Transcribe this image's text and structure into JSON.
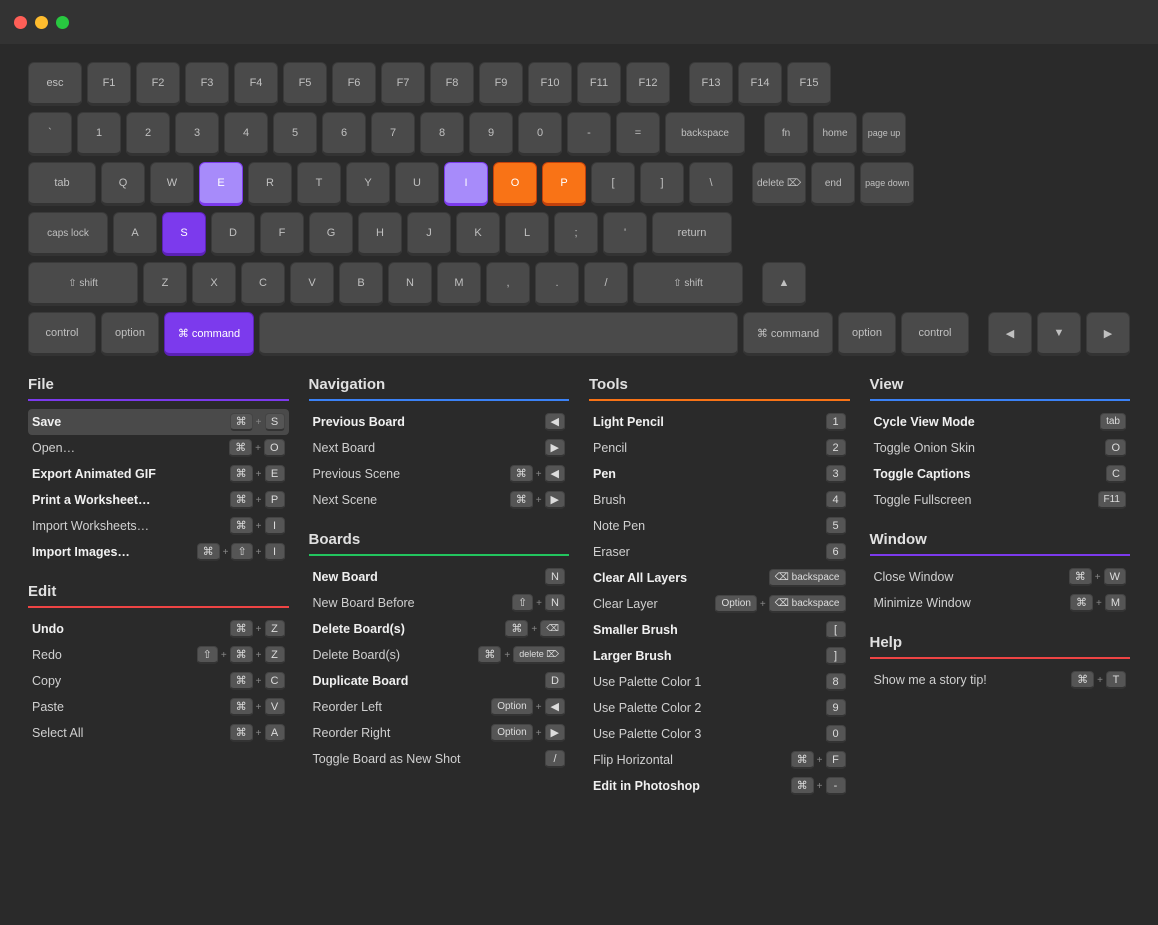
{
  "titleBar": {
    "dots": [
      "red",
      "yellow",
      "green"
    ]
  },
  "keyboard": {
    "rows": [
      [
        "esc",
        "F1",
        "F2",
        "F3",
        "F4",
        "F5",
        "F6",
        "F7",
        "F8",
        "F9",
        "F10",
        "F11",
        "F12",
        "F13",
        "F14",
        "F15"
      ],
      [
        "`",
        "1",
        "2",
        "3",
        "4",
        "5",
        "6",
        "7",
        "8",
        "9",
        "0",
        "-",
        "=",
        "backspace",
        "fn",
        "home",
        "page up"
      ],
      [
        "tab",
        "Q",
        "W",
        "E",
        "R",
        "T",
        "Y",
        "U",
        "I",
        "O",
        "P",
        "[",
        "]",
        "\\",
        "delete",
        "end",
        "page down"
      ],
      [
        "caps lock",
        "A",
        "S",
        "D",
        "F",
        "G",
        "H",
        "J",
        "K",
        "L",
        ";",
        "'",
        "return"
      ],
      [
        "shift",
        "Z",
        "X",
        "C",
        "V",
        "B",
        "N",
        "M",
        ",",
        ".",
        "/",
        "shift"
      ],
      [
        "control",
        "option",
        "command",
        "",
        "command",
        "option",
        "control"
      ]
    ]
  },
  "sections": {
    "file": {
      "title": "File",
      "dividerClass": "divider-purple",
      "items": [
        {
          "label": "Save",
          "bold": true,
          "keys": [
            "⌘",
            "S"
          ],
          "highlighted": true
        },
        {
          "label": "Open…",
          "keys": [
            "⌘",
            "O"
          ]
        },
        {
          "label": "Export Animated GIF",
          "bold": true,
          "keys": [
            "⌘",
            "E"
          ]
        },
        {
          "label": "Print a Worksheet…",
          "bold": true,
          "keys": [
            "⌘",
            "P"
          ]
        },
        {
          "label": "Import Worksheets…",
          "keys": [
            "⌘",
            "I"
          ]
        },
        {
          "label": "Import Images…",
          "bold": true,
          "keys": [
            "⌘",
            "⇧",
            "I"
          ]
        }
      ]
    },
    "edit": {
      "title": "Edit",
      "dividerClass": "divider-red",
      "items": [
        {
          "label": "Undo",
          "bold": true,
          "keys": [
            "⌘",
            "Z"
          ]
        },
        {
          "label": "Redo",
          "keys": [
            "⇧",
            "⌘",
            "Z"
          ]
        },
        {
          "label": "Copy",
          "keys": [
            "⌘",
            "C"
          ]
        },
        {
          "label": "Paste",
          "keys": [
            "⌘",
            "V"
          ]
        },
        {
          "label": "Select All",
          "keys": [
            "⌘",
            "A"
          ]
        }
      ]
    },
    "navigation": {
      "title": "Navigation",
      "dividerClass": "divider-blue",
      "items": [
        {
          "label": "Previous Board",
          "bold": true,
          "keys": [
            "◀"
          ]
        },
        {
          "label": "Next Board",
          "keys": [
            "▶"
          ]
        },
        {
          "label": "Previous Scene",
          "keys": [
            "⌘",
            "◀"
          ]
        },
        {
          "label": "Next Scene",
          "keys": [
            "⌘",
            "▶"
          ]
        }
      ]
    },
    "boards": {
      "title": "Boards",
      "dividerClass": "divider-green",
      "items": [
        {
          "label": "New Board",
          "bold": true,
          "keys": [
            "N"
          ]
        },
        {
          "label": "New Board Before",
          "keys": [
            "⇧",
            "N"
          ]
        },
        {
          "label": "Delete Board(s)",
          "bold": true,
          "keys": [
            "⌘",
            "⌫"
          ]
        },
        {
          "label": "Delete Board(s)",
          "keys": [
            "⌘",
            "delete"
          ]
        },
        {
          "label": "Duplicate Board",
          "bold": true,
          "keys": [
            "D"
          ]
        },
        {
          "label": "Reorder Left",
          "keys": [
            "Option",
            "◀"
          ]
        },
        {
          "label": "Reorder Right",
          "keys": [
            "Option",
            "▶"
          ]
        },
        {
          "label": "Toggle Board as New Shot",
          "keys": [
            "/"
          ]
        },
        {
          "label": "",
          "keys": []
        }
      ]
    },
    "tools": {
      "title": "Tools",
      "dividerClass": "divider-orange",
      "items": [
        {
          "label": "Light Pencil",
          "bold": true,
          "keys": [
            "1"
          ]
        },
        {
          "label": "Pencil",
          "keys": [
            "2"
          ]
        },
        {
          "label": "Pen",
          "bold": true,
          "keys": [
            "3"
          ]
        },
        {
          "label": "Brush",
          "keys": [
            "4"
          ]
        },
        {
          "label": "Note Pen",
          "keys": [
            "5"
          ]
        },
        {
          "label": "Eraser",
          "keys": [
            "6"
          ]
        },
        {
          "label": "Clear All Layers",
          "bold": true,
          "keys": [
            "⌫"
          ]
        },
        {
          "label": "Clear Layer",
          "keys": [
            "Option",
            "⌫"
          ]
        },
        {
          "label": "Smaller Brush",
          "bold": true,
          "keys": [
            "["
          ]
        },
        {
          "label": "Larger Brush",
          "bold": true,
          "keys": [
            "]"
          ]
        },
        {
          "label": "Use Palette Color 1",
          "keys": [
            "8"
          ]
        },
        {
          "label": "Use Palette Color 2",
          "keys": [
            "9"
          ]
        },
        {
          "label": "Use Palette Color 3",
          "keys": [
            "0"
          ]
        },
        {
          "label": "Flip Horizontal",
          "keys": [
            "⌘",
            "F"
          ]
        },
        {
          "label": "Edit in Photoshop",
          "bold": true,
          "keys": [
            "⌘",
            "-"
          ]
        }
      ]
    },
    "view": {
      "title": "View",
      "dividerClass": "divider-blue",
      "items": [
        {
          "label": "Cycle View Mode",
          "bold": true,
          "keys": [
            "tab"
          ]
        },
        {
          "label": "Toggle Onion Skin",
          "keys": [
            "O"
          ]
        },
        {
          "label": "Toggle Captions",
          "bold": true,
          "keys": [
            "C"
          ]
        },
        {
          "label": "Toggle Fullscreen",
          "keys": [
            "F11"
          ]
        }
      ]
    },
    "window": {
      "title": "Window",
      "dividerClass": "divider-purple",
      "items": [
        {
          "label": "Close Window",
          "keys": [
            "⌘",
            "W"
          ]
        },
        {
          "label": "Minimize Window",
          "keys": [
            "⌘",
            "M"
          ]
        }
      ]
    },
    "help": {
      "title": "Help",
      "dividerClass": "divider-red",
      "items": [
        {
          "label": "Show me a story tip!",
          "keys": [
            "⌘",
            "T"
          ]
        }
      ]
    }
  }
}
